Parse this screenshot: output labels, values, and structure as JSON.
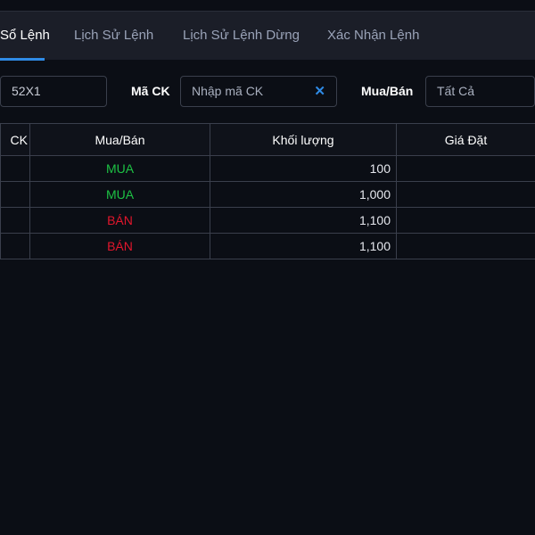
{
  "tabs": [
    {
      "label": "Sổ Lệnh"
    },
    {
      "label": "Lịch Sử Lệnh"
    },
    {
      "label": "Lịch Sử Lệnh Dừng"
    },
    {
      "label": "Xác Nhận Lệnh"
    }
  ],
  "filters": {
    "account_value": "52X1",
    "symbol_label": "Mã CK",
    "symbol_placeholder": "Nhập mã CK",
    "side_label": "Mua/Bán",
    "side_value": "Tất Cả"
  },
  "table": {
    "headers": [
      "CK",
      "Mua/Bán",
      "Khối lượng",
      "Giá Đặt"
    ],
    "rows": [
      {
        "side": "MUA",
        "qty": "100"
      },
      {
        "side": "MUA",
        "qty": "1,000"
      },
      {
        "side": "BÁN",
        "qty": "1,100"
      },
      {
        "side": "BÁN",
        "qty": "1,100"
      }
    ]
  },
  "colors": {
    "buy": "#1dc244",
    "sell": "#e3162c",
    "accent": "#2f8be6"
  }
}
